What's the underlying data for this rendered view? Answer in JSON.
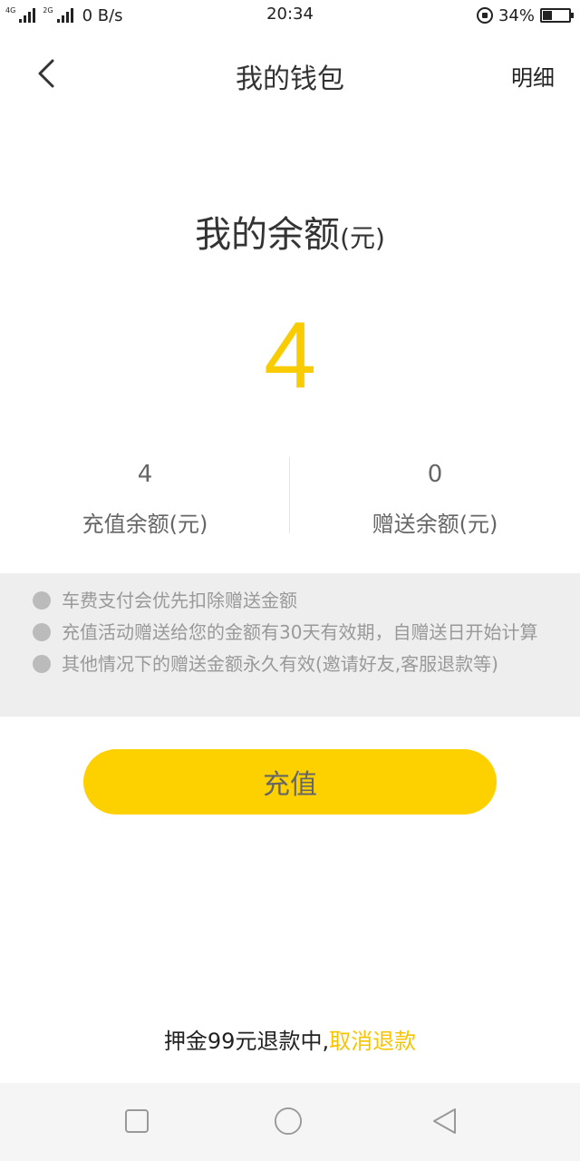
{
  "status_bar": {
    "net1": "4G",
    "net2": "2G",
    "speed": "0 B/s",
    "time": "20:34",
    "battery": "34%"
  },
  "header": {
    "title": "我的钱包",
    "detail": "明细",
    "back_icon": "chevron-left-icon"
  },
  "balance": {
    "title": "我的余额",
    "unit": "(元)",
    "amount": "4"
  },
  "sub_balances": [
    {
      "value": "4",
      "label": "充值余额(元)"
    },
    {
      "value": "0",
      "label": "赠送余额(元)"
    }
  ],
  "notices": [
    "车费支付会优先扣除赠送金额",
    "充值活动赠送给您的金额有30天有效期，自赠送日开始计算",
    "其他情况下的赠送金额永久有效(邀请好友,客服退款等)"
  ],
  "recharge_button": "充值",
  "deposit": {
    "text": "押金99元退款中,",
    "link": "取消退款"
  },
  "colors": {
    "accent": "#fdd100",
    "amount": "#f8cc00",
    "link": "#f8c400"
  }
}
